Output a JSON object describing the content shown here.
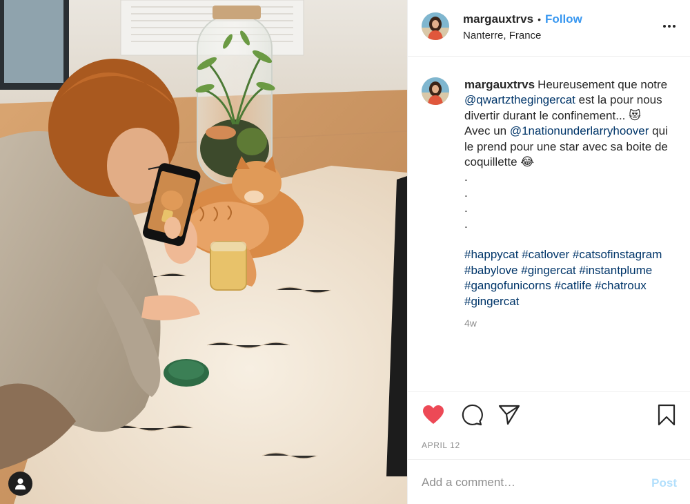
{
  "post": {
    "username": "margauxtrvs",
    "separator": "•",
    "follow_label": "Follow",
    "location": "Nanterre, France"
  },
  "caption": {
    "username": "margauxtrvs",
    "text_1": "Heureusement que notre ",
    "mention_1": "@qwartzthegingercat",
    "text_2": " est la pour nous divertir durant le confinement... ",
    "emoji_1": "😻",
    "text_3": "Avec un ",
    "mention_2": "@1nationunderlarryhoover",
    "text_4": " qui le prend pour une star avec sa boite de coquillette ",
    "emoji_2": "😂",
    "dots": [
      ".",
      ".",
      ".",
      "."
    ],
    "hashtags": [
      "#happycat",
      "#catlover",
      "#catsofinstagram",
      "#babylove",
      "#gingercat",
      "#instantplume",
      "#gangofunicorns",
      "#catlife",
      "#chatroux",
      "#gingercat"
    ],
    "time": "4w"
  },
  "actions": {
    "date": "APRIL 12",
    "like_icon": "heart-filled-icon",
    "comment_icon": "speech-bubble-icon",
    "share_icon": "paper-plane-icon",
    "save_icon": "bookmark-icon",
    "like_color": "#ed4956"
  },
  "comment_box": {
    "placeholder": "Add a comment…",
    "post_label": "Post"
  }
}
